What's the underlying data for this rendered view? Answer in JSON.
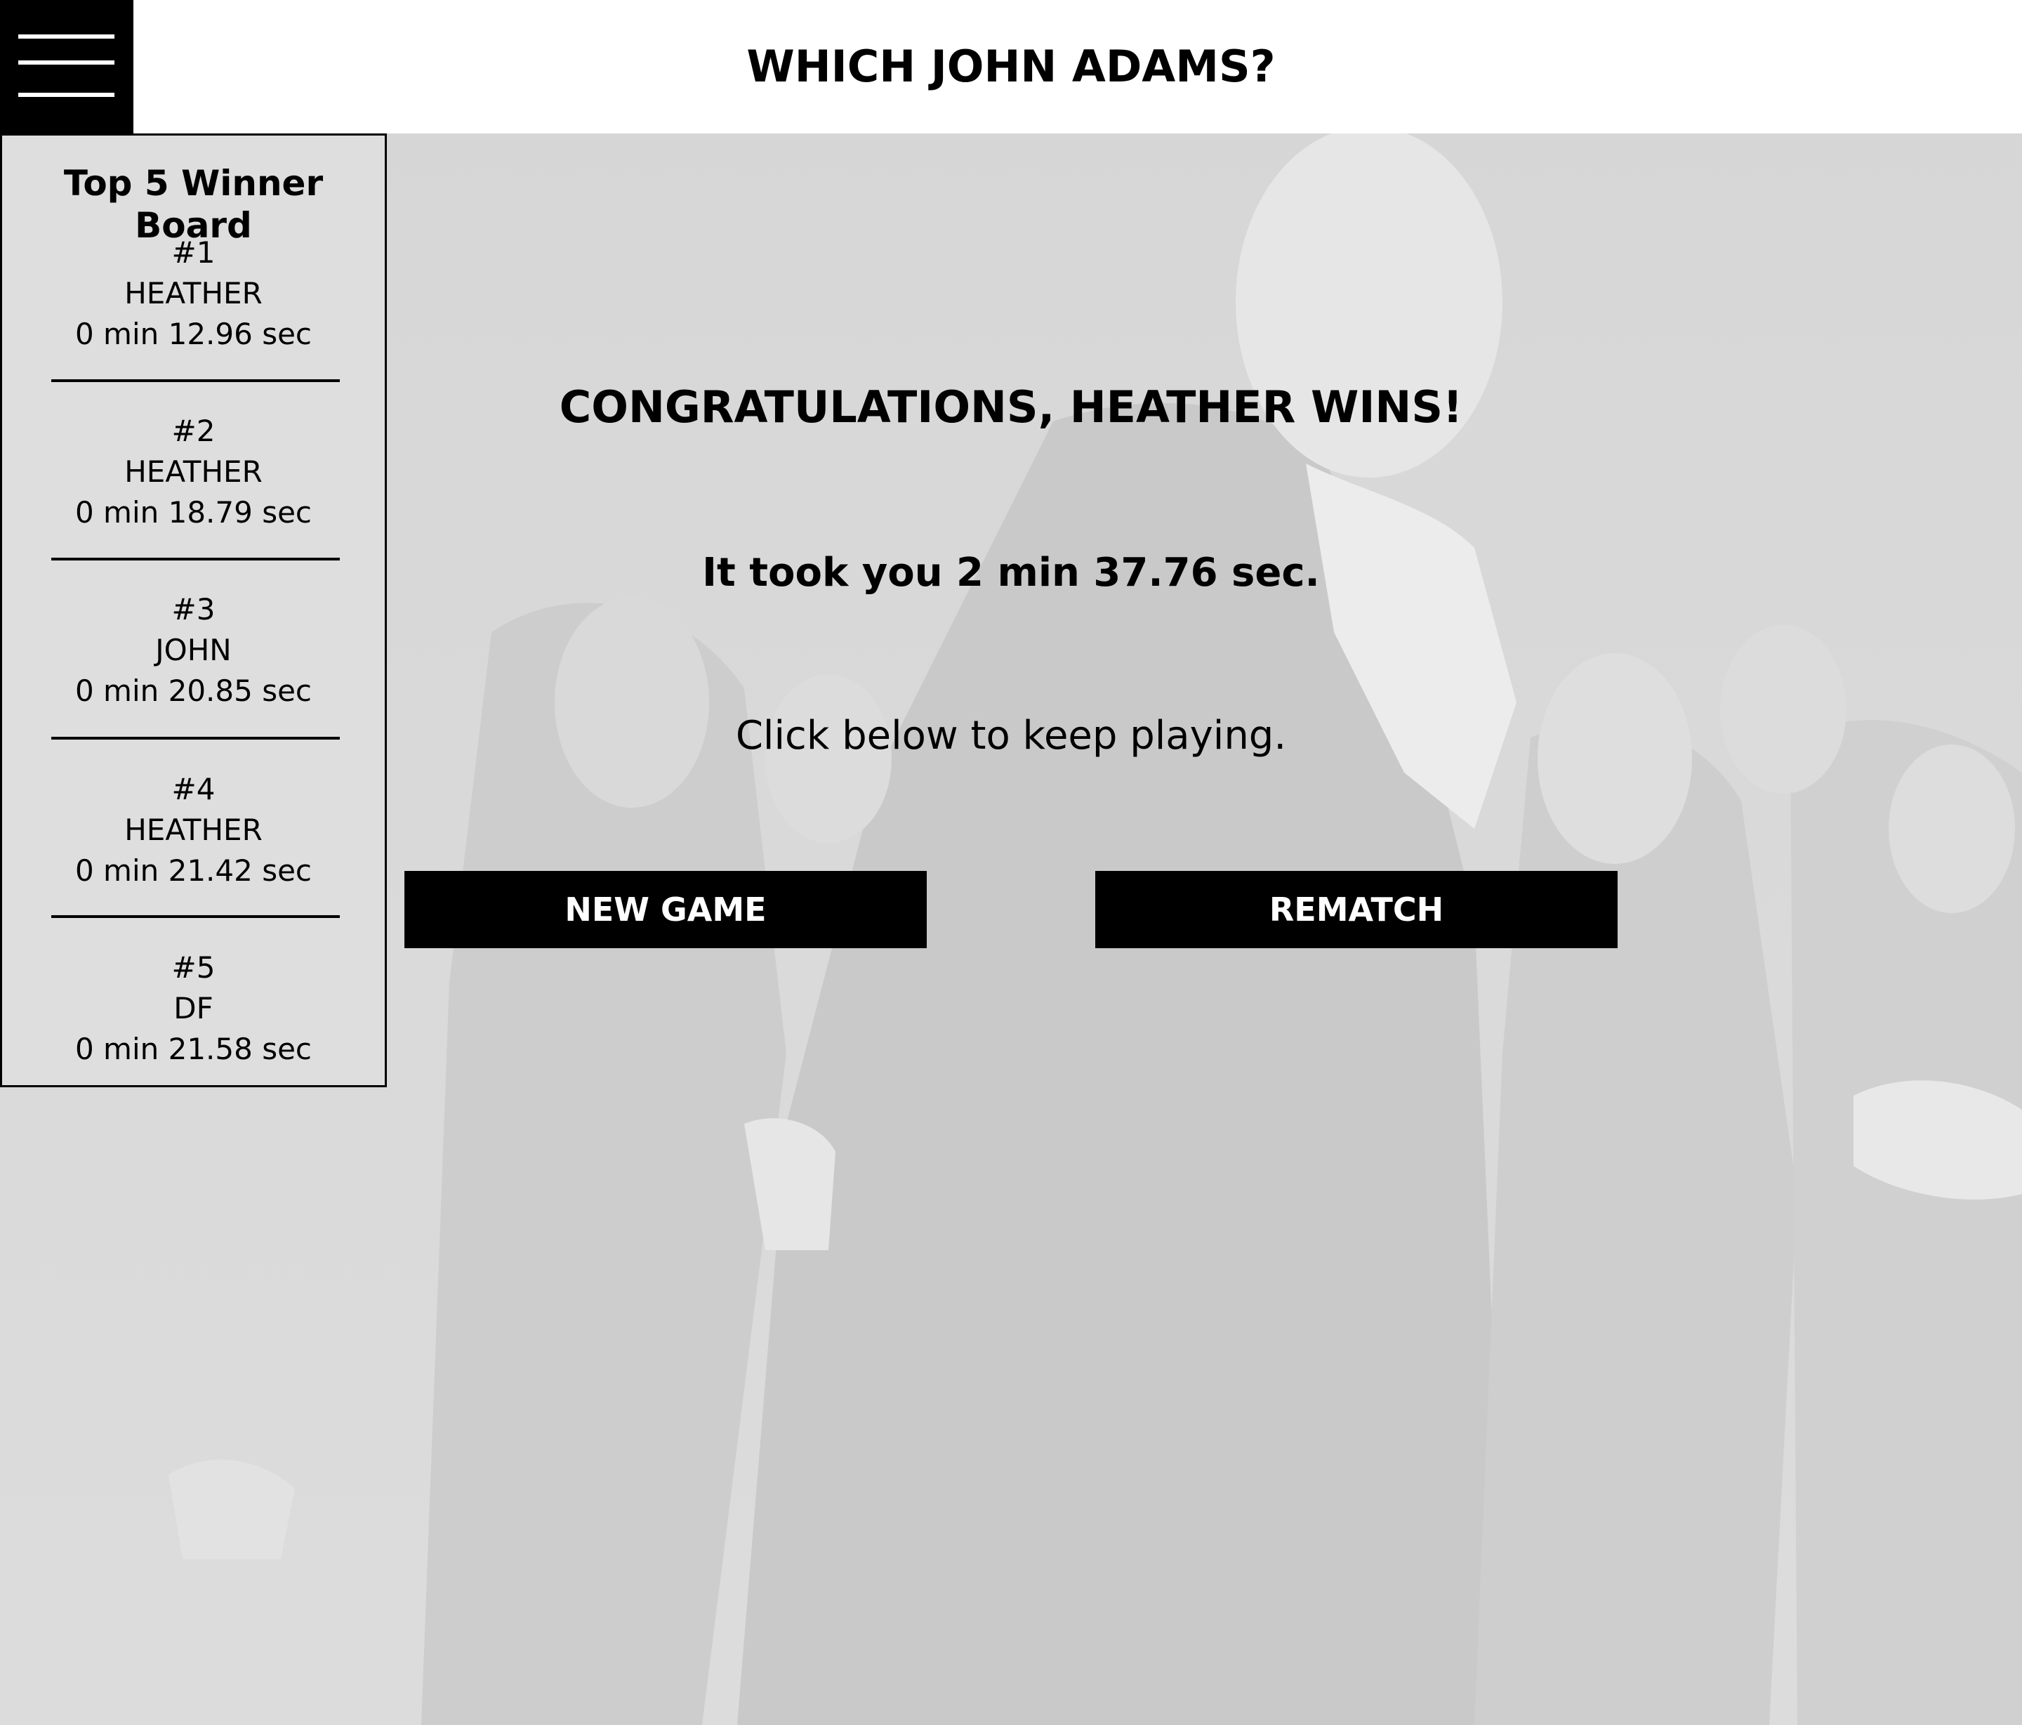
{
  "header": {
    "title": "WHICH JOHN ADAMS?",
    "menu_icon": "hamburger-menu-icon"
  },
  "board": {
    "title": "Top 5 Winner Board",
    "entries": [
      {
        "rank": "#1",
        "name": "HEATHER",
        "time": "0 min 12.96 sec"
      },
      {
        "rank": "#2",
        "name": "HEATHER",
        "time": "0 min 18.79 sec"
      },
      {
        "rank": "#3",
        "name": "JOHN",
        "time": "0 min 20.85 sec"
      },
      {
        "rank": "#4",
        "name": "HEATHER",
        "time": "0 min 21.42 sec"
      },
      {
        "rank": "#5",
        "name": "DF",
        "time": "0 min 21.58 sec"
      }
    ]
  },
  "result": {
    "headline": "CONGRATULATIONS, HEATHER WINS!",
    "time_message": "It took you 2 min 37.76 sec.",
    "prompt": "Click below to keep playing."
  },
  "actions": {
    "new_game_label": "NEW GAME",
    "rematch_label": "REMATCH"
  },
  "colors": {
    "header_bg": "#ffffff",
    "menu_bg": "#000000",
    "button_bg": "#000000",
    "button_text": "#ffffff",
    "page_bg": "#dadada"
  }
}
